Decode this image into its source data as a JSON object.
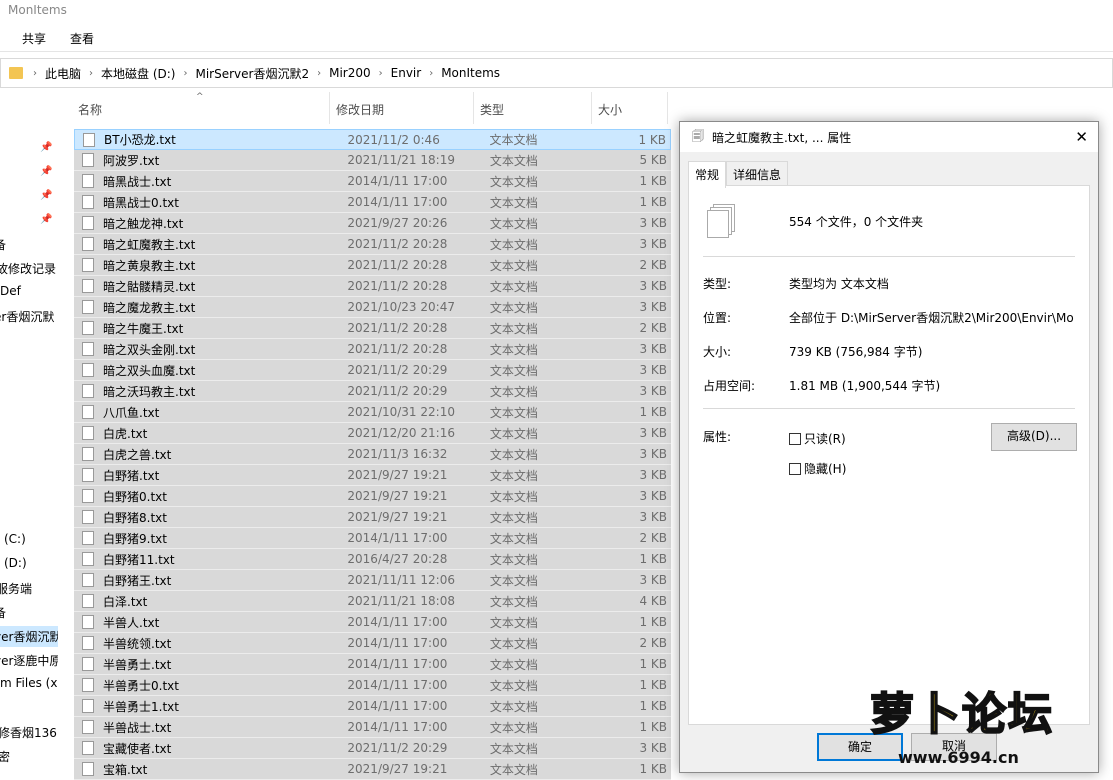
{
  "window": {
    "title": "MonItems"
  },
  "ribbon": {
    "share": "共享",
    "view": "查看"
  },
  "address": [
    "此电脑",
    "本地磁盘 (D:)",
    "MirServer香烟沉默2",
    "Mir200",
    "Envir",
    "MonItems"
  ],
  "columns": {
    "name": "名称",
    "date": "修改日期",
    "type": "类型",
    "size": "大小"
  },
  "nav_items": [
    "备",
    "故修改记录",
    "Def",
    "er香烟沉默",
    "(C:)",
    "(D:)",
    "服务端",
    "备",
    "ver香烟沉默",
    "ver逐鹿中原",
    "m Files (x",
    "修香烟136",
    "密"
  ],
  "files": [
    {
      "name": "BT小恐龙.txt",
      "date": "2021/11/2 0:46",
      "type": "文本文档",
      "size": "1 KB"
    },
    {
      "name": "阿波罗.txt",
      "date": "2021/11/21 18:19",
      "type": "文本文档",
      "size": "5 KB"
    },
    {
      "name": "暗黑战士.txt",
      "date": "2014/1/11 17:00",
      "type": "文本文档",
      "size": "1 KB"
    },
    {
      "name": "暗黑战士0.txt",
      "date": "2014/1/11 17:00",
      "type": "文本文档",
      "size": "1 KB"
    },
    {
      "name": "暗之触龙神.txt",
      "date": "2021/9/27 20:26",
      "type": "文本文档",
      "size": "3 KB"
    },
    {
      "name": "暗之虹魔教主.txt",
      "date": "2021/11/2 20:28",
      "type": "文本文档",
      "size": "3 KB"
    },
    {
      "name": "暗之黄泉教主.txt",
      "date": "2021/11/2 20:28",
      "type": "文本文档",
      "size": "2 KB"
    },
    {
      "name": "暗之骷髅精灵.txt",
      "date": "2021/11/2 20:28",
      "type": "文本文档",
      "size": "3 KB"
    },
    {
      "name": "暗之魔龙教主.txt",
      "date": "2021/10/23 20:47",
      "type": "文本文档",
      "size": "3 KB"
    },
    {
      "name": "暗之牛魔王.txt",
      "date": "2021/11/2 20:28",
      "type": "文本文档",
      "size": "2 KB"
    },
    {
      "name": "暗之双头金刚.txt",
      "date": "2021/11/2 20:28",
      "type": "文本文档",
      "size": "3 KB"
    },
    {
      "name": "暗之双头血魔.txt",
      "date": "2021/11/2 20:29",
      "type": "文本文档",
      "size": "3 KB"
    },
    {
      "name": "暗之沃玛教主.txt",
      "date": "2021/11/2 20:29",
      "type": "文本文档",
      "size": "3 KB"
    },
    {
      "name": "八爪鱼.txt",
      "date": "2021/10/31 22:10",
      "type": "文本文档",
      "size": "1 KB"
    },
    {
      "name": "白虎.txt",
      "date": "2021/12/20 21:16",
      "type": "文本文档",
      "size": "3 KB"
    },
    {
      "name": "白虎之兽.txt",
      "date": "2021/11/3 16:32",
      "type": "文本文档",
      "size": "3 KB"
    },
    {
      "name": "白野猪.txt",
      "date": "2021/9/27 19:21",
      "type": "文本文档",
      "size": "3 KB"
    },
    {
      "name": "白野猪0.txt",
      "date": "2021/9/27 19:21",
      "type": "文本文档",
      "size": "3 KB"
    },
    {
      "name": "白野猪8.txt",
      "date": "2021/9/27 19:21",
      "type": "文本文档",
      "size": "3 KB"
    },
    {
      "name": "白野猪9.txt",
      "date": "2014/1/11 17:00",
      "type": "文本文档",
      "size": "2 KB"
    },
    {
      "name": "白野猪11.txt",
      "date": "2016/4/27 20:28",
      "type": "文本文档",
      "size": "1 KB"
    },
    {
      "name": "白野猪王.txt",
      "date": "2021/11/11 12:06",
      "type": "文本文档",
      "size": "3 KB"
    },
    {
      "name": "白泽.txt",
      "date": "2021/11/21 18:08",
      "type": "文本文档",
      "size": "4 KB"
    },
    {
      "name": "半兽人.txt",
      "date": "2014/1/11 17:00",
      "type": "文本文档",
      "size": "1 KB"
    },
    {
      "name": "半兽统领.txt",
      "date": "2014/1/11 17:00",
      "type": "文本文档",
      "size": "2 KB"
    },
    {
      "name": "半兽勇士.txt",
      "date": "2014/1/11 17:00",
      "type": "文本文档",
      "size": "1 KB"
    },
    {
      "name": "半兽勇士0.txt",
      "date": "2014/1/11 17:00",
      "type": "文本文档",
      "size": "1 KB"
    },
    {
      "name": "半兽勇士1.txt",
      "date": "2014/1/11 17:00",
      "type": "文本文档",
      "size": "1 KB"
    },
    {
      "name": "半兽战士.txt",
      "date": "2014/1/11 17:00",
      "type": "文本文档",
      "size": "1 KB"
    },
    {
      "name": "宝藏使者.txt",
      "date": "2021/11/2 20:29",
      "type": "文本文档",
      "size": "3 KB"
    },
    {
      "name": "宝箱.txt",
      "date": "2021/9/27 19:21",
      "type": "文本文档",
      "size": "1 KB"
    }
  ],
  "dialog": {
    "title": "暗之虹魔教主.txt, ... 属性",
    "tab_general": "常规",
    "tab_details": "详细信息",
    "summary": "554 个文件，0 个文件夹",
    "type_label": "类型:",
    "type_value": "类型均为 文本文档",
    "location_label": "位置:",
    "location_value": "全部位于 D:\\MirServer香烟沉默2\\Mir200\\Envir\\Mo",
    "size_label": "大小:",
    "size_value": "739 KB (756,984 字节)",
    "disk_label": "占用空间:",
    "disk_value": "1.81 MB (1,900,544 字节)",
    "attr_label": "属性:",
    "readonly": "只读(R)",
    "hidden": "隐藏(H)",
    "advanced": "高级(D)...",
    "ok": "确定",
    "cancel": "取消"
  },
  "watermark": {
    "text": "萝卜论坛",
    "url": "www.6994.cn"
  }
}
